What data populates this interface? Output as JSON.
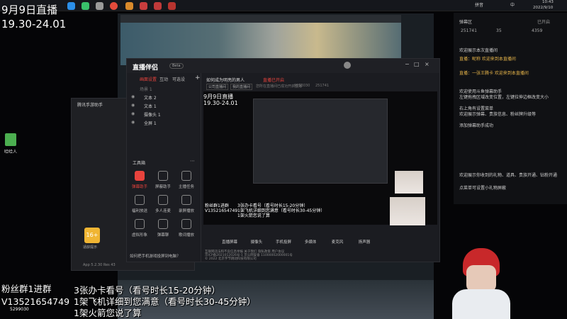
{
  "overlay": {
    "date_title": "9月9日直播",
    "time_range": "19.30-24.01",
    "fans_line": "粉丝群1进群",
    "id_line": "V13521654749",
    "small_id": "5299030",
    "offer_1": "3张办卡看号（看号时长15-20分钟）",
    "offer_2": "1架飞机详细到您满意（看号时长30-45分钟）",
    "offer_3": "1架火箭您说了算"
  },
  "taskbar": {
    "clock_time": "10:43",
    "clock_date": "2022/9/10",
    "tray_label": "拼音",
    "tray_label2": "中"
  },
  "desktop": {
    "icon_label": "哈哈人"
  },
  "tencent": {
    "title": "腾讯手游助手",
    "age_badge": "16+",
    "age_caption": "适龄提示",
    "version": "App 5.2.30 Res 43"
  },
  "main_window": {
    "app_name": "直播伴侣",
    "app_badge": "Beta",
    "tabs": [
      "画面设置",
      "互动",
      "可选设"
    ],
    "add_label": "+",
    "sources": [
      "文本 2",
      "文本 1",
      "摄像头 1",
      "全屏 1"
    ],
    "source_group": "场景 1",
    "tools_title": "工具箱",
    "tools": [
      "弹幕助手",
      "屏蔽助手",
      "主播任务",
      "福利放送",
      "多人连麦",
      "录屏播放",
      "虚拟形象",
      "弹幕聊",
      "歌词播放"
    ],
    "status_notice": "如何把手机游戏投屏到电脑？",
    "room_title": "如何成为明亮的男人",
    "room_status": "直播已开启",
    "room_tags": [
      "公司直播间",
      "我的直播间"
    ],
    "room_subline": "您所在直播间已成功开启直播",
    "room_id": "9253030",
    "online": "251741",
    "preview_title": "9月9日直播",
    "preview_time": "19.30-24.01",
    "preview_lines": [
      "3张办卡看号（看号时长15-20分钟）",
      "1架飞机详细到您满意（看号时长30-45分钟）",
      "1架火箭您说了算"
    ],
    "preview_left": [
      "粉丝群1进群",
      "V13521654749"
    ],
    "bottom_bar": [
      "直播屏幕",
      "摄像头",
      "手机投屏",
      "多媒体",
      "麦克风",
      "扬声器"
    ],
    "footer_lines": [
      "互联网违法和不良信息举报 关于我们 隐私政策 用户协议",
      "京ICP备2021012026号-1 京公网安备 11000002000001号",
      "© 2022 北京字节跳动科技有限公司"
    ]
  },
  "chat": {
    "title": "弹幕区",
    "header_right": "已开启",
    "stat_1": "251741",
    "stat_2": "35",
    "stat_3": "4359",
    "messages": [
      "欢迎展示本次直播间",
      "直播：昵称 欢迎来到本直播间",
      "直播：一张王腾卡 欢迎来到本直播间",
      "欢迎使用斗鱼弹幕助手",
      "左键拖拽区域改变位置，左键拉伸边框改变大小",
      "右上角有设置菜单",
      "欢迎展示弹幕、贵族信息、粉丝牌升级等",
      "添加弹幕助手成功",
      "欢迎展示你收到的礼物、道具、贵族开通、钻粉开通",
      "点菜单可设置小礼物屏蔽"
    ]
  },
  "colors": {
    "accent": "#e8433d",
    "chat_user": "#e7b54a",
    "link_blue": "#4a90e2"
  }
}
